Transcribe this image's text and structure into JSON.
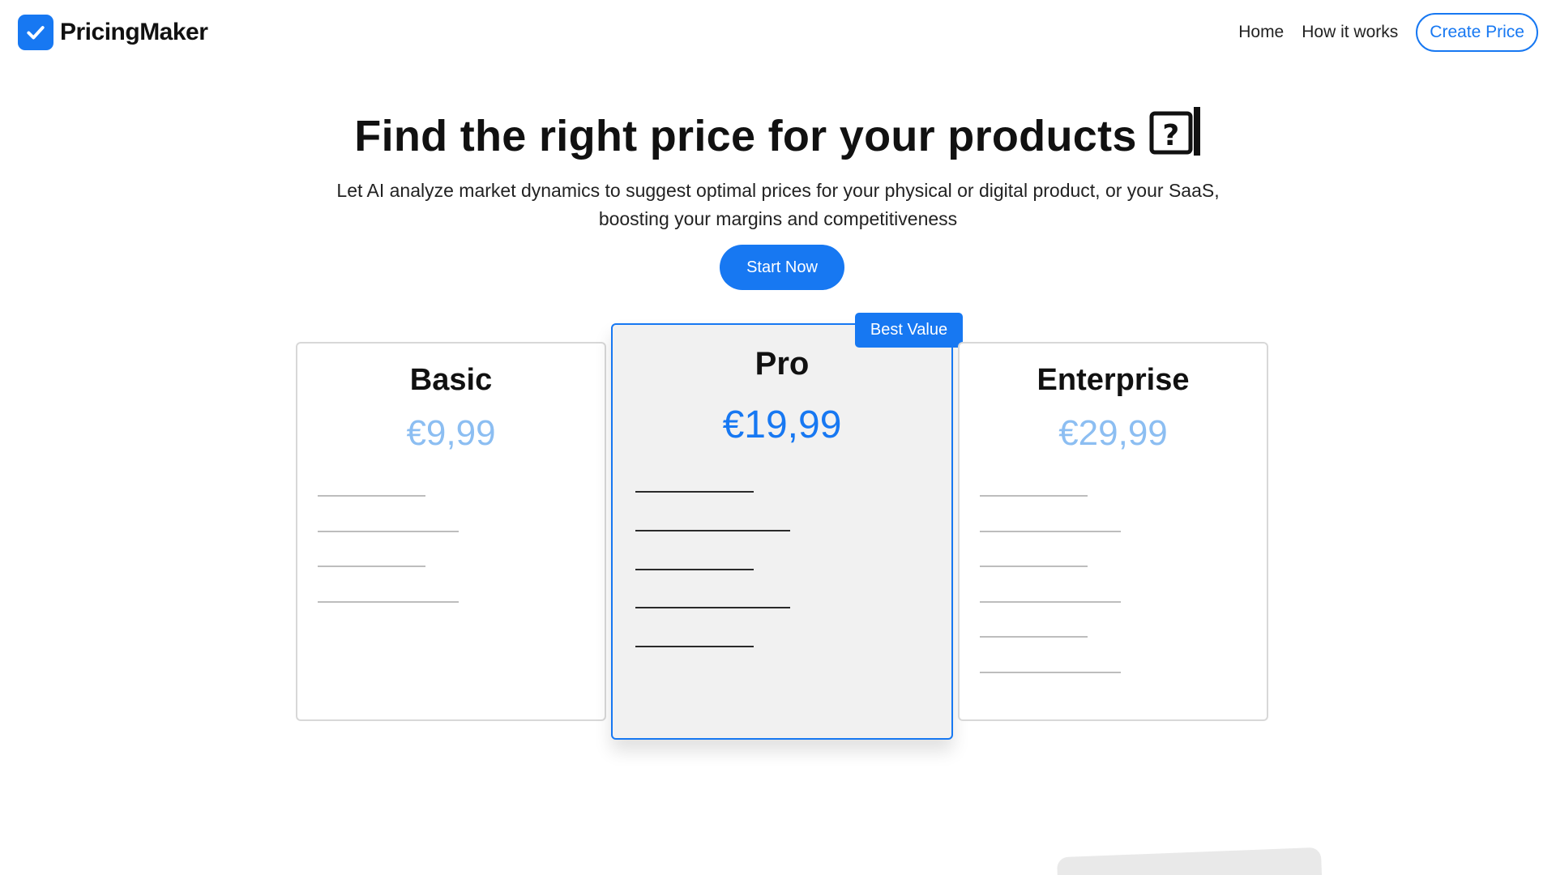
{
  "header": {
    "logo_text": "PricingMaker",
    "nav": [
      "Home",
      "How it works"
    ],
    "cta": "Create Price"
  },
  "hero": {
    "title": "Find the right price for your products",
    "subtitle_line1": "Let AI analyze market dynamics to suggest optimal prices for your physical or digital product, or your SaaS,",
    "subtitle_line2": "boosting your margins and competitiveness",
    "button": "Start Now"
  },
  "plans": [
    {
      "name": "Basic",
      "price": "€9,99"
    },
    {
      "name": "Pro",
      "price": "€19,99",
      "badge": "Best Value"
    },
    {
      "name": "Enterprise",
      "price": "€29,99"
    }
  ],
  "colors": {
    "accent": "#1778f2",
    "price_muted": "#8cbef2",
    "card_pro_bg": "#f1f1f1"
  },
  "icons": [
    "check-icon",
    "question-box-icon"
  ]
}
